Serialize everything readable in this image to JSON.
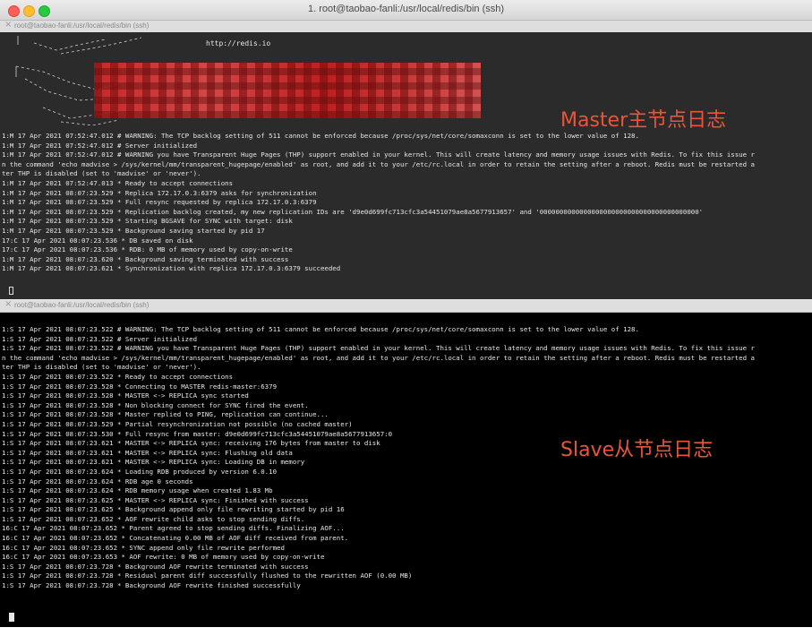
{
  "window": {
    "title": "1. root@taobao-fanli:/usr/local/redis/bin (ssh)",
    "colors": {
      "close": "#fd5f57",
      "minimize": "#febc2e",
      "zoom": "#28c840"
    }
  },
  "tabs": [
    {
      "close": "×",
      "label": "root@taobao-fanli:/usr/local/redis/bin (ssh)"
    },
    {
      "close": "×",
      "label": "root@taobao-fanli:/usr/local/redis/bin (ssh)"
    }
  ],
  "master": {
    "url": "http://redis.io",
    "annotation": "Master主节点日志",
    "lines": [
      "1:M 17 Apr 2021 07:52:47.012 # WARNING: The TCP backlog setting of 511 cannot be enforced because /proc/sys/net/core/somaxconn is set to the lower value of 128.",
      "1:M 17 Apr 2021 07:52:47.012 # Server initialized",
      "1:M 17 Apr 2021 07:52:47.012 # WARNING you have Transparent Huge Pages (THP) support enabled in your kernel. This will create latency and memory usage issues with Redis. To fix this issue r",
      "n the command 'echo madvise > /sys/kernel/mm/transparent_hugepage/enabled' as root, and add it to your /etc/rc.local in order to retain the setting after a reboot. Redis must be restarted a",
      "ter THP is disabled (set to 'madvise' or 'never').",
      "1:M 17 Apr 2021 07:52:47.013 * Ready to accept connections",
      "1:M 17 Apr 2021 08:07:23.529 * Replica 172.17.0.3:6379 asks for synchronization",
      "1:M 17 Apr 2021 08:07:23.529 * Full resync requested by replica 172.17.0.3:6379",
      "1:M 17 Apr 2021 08:07:23.529 * Replication backlog created, my new replication IDs are 'd9e0d699fc713cfc3a54451079ae8a5677913657' and '0000000000000000000000000000000000000000'",
      "1:M 17 Apr 2021 08:07:23.529 * Starting BGSAVE for SYNC with target: disk",
      "1:M 17 Apr 2021 08:07:23.529 * Background saving started by pid 17",
      "17:C 17 Apr 2021 08:07:23.536 * DB saved on disk",
      "17:C 17 Apr 2021 08:07:23.536 * RDB: 0 MB of memory used by copy-on-write",
      "1:M 17 Apr 2021 08:07:23.620 * Background saving terminated with success",
      "1:M 17 Apr 2021 08:07:23.621 * Synchronization with replica 172.17.0.3:6379 succeeded"
    ]
  },
  "slave": {
    "annotation": "Slave从节点日志",
    "lines": [
      "1:S 17 Apr 2021 08:07:23.522 # WARNING: The TCP backlog setting of 511 cannot be enforced because /proc/sys/net/core/somaxconn is set to the lower value of 128.",
      "1:S 17 Apr 2021 08:07:23.522 # Server initialized",
      "1:S 17 Apr 2021 08:07:23.522 # WARNING you have Transparent Huge Pages (THP) support enabled in your kernel. This will create latency and memory usage issues with Redis. To fix this issue r",
      "n the command 'echo madvise > /sys/kernel/mm/transparent_hugepage/enabled' as root, and add it to your /etc/rc.local in order to retain the setting after a reboot. Redis must be restarted a",
      "ter THP is disabled (set to 'madvise' or 'never').",
      "1:S 17 Apr 2021 08:07:23.522 * Ready to accept connections",
      "1:S 17 Apr 2021 08:07:23.528 * Connecting to MASTER redis-master:6379",
      "1:S 17 Apr 2021 08:07:23.528 * MASTER <-> REPLICA sync started",
      "1:S 17 Apr 2021 08:07:23.528 * Non blocking connect for SYNC fired the event.",
      "1:S 17 Apr 2021 08:07:23.528 * Master replied to PING, replication can continue...",
      "1:S 17 Apr 2021 08:07:23.529 * Partial resynchronization not possible (no cached master)",
      "1:S 17 Apr 2021 08:07:23.530 * Full resync from master: d9e0d699fc713cfc3a54451079ae8a5677913657:0",
      "1:S 17 Apr 2021 08:07:23.621 * MASTER <-> REPLICA sync: receiving 176 bytes from master to disk",
      "1:S 17 Apr 2021 08:07:23.621 * MASTER <-> REPLICA sync: Flushing old data",
      "1:S 17 Apr 2021 08:07:23.621 * MASTER <-> REPLICA sync: Loading DB in memory",
      "1:S 17 Apr 2021 08:07:23.624 * Loading RDB produced by version 6.0.10",
      "1:S 17 Apr 2021 08:07:23.624 * RDB age 0 seconds",
      "1:S 17 Apr 2021 08:07:23.624 * RDB memory usage when created 1.83 Mb",
      "1:S 17 Apr 2021 08:07:23.625 * MASTER <-> REPLICA sync: Finished with success",
      "1:S 17 Apr 2021 08:07:23.625 * Background append only file rewriting started by pid 16",
      "1:S 17 Apr 2021 08:07:23.652 * AOF rewrite child asks to stop sending diffs.",
      "16:C 17 Apr 2021 08:07:23.652 * Parent agreed to stop sending diffs. Finalizing AOF...",
      "16:C 17 Apr 2021 08:07:23.652 * Concatenating 0.00 MB of AOF diff received from parent.",
      "16:C 17 Apr 2021 08:07:23.652 * SYNC append only file rewrite performed",
      "16:C 17 Apr 2021 08:07:23.653 * AOF rewrite: 0 MB of memory used by copy-on-write",
      "1:S 17 Apr 2021 08:07:23.728 * Background AOF rewrite terminated with success",
      "1:S 17 Apr 2021 08:07:23.728 * Residual parent diff successfully flushed to the rewritten AOF (0.00 MB)",
      "1:S 17 Apr 2021 08:07:23.728 * Background AOF rewrite finished successfully"
    ]
  }
}
